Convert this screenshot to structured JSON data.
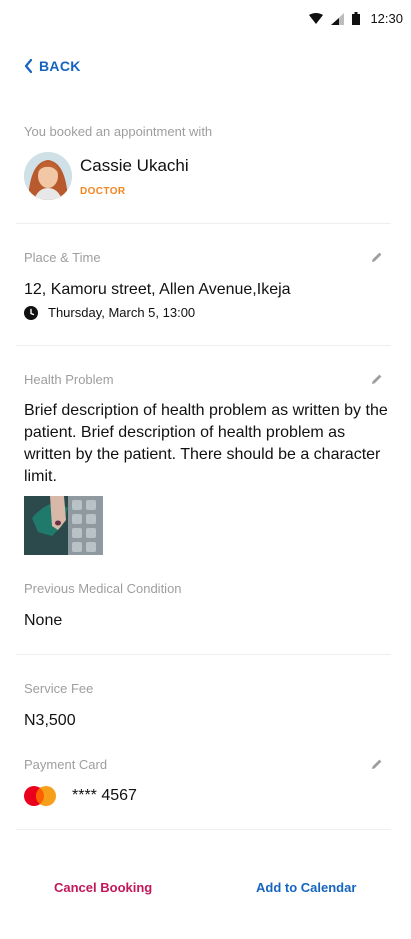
{
  "status_bar": {
    "time": "12:30",
    "icons": [
      "wifi-icon",
      "signal-icon",
      "battery-icon"
    ]
  },
  "nav": {
    "back_label": "BACK"
  },
  "doctor": {
    "intro": "You booked an appointment with",
    "name": "Cassie Ukachi",
    "role": "DOCTOR"
  },
  "place_time": {
    "label": "Place & Time",
    "address": "12, Kamoru street, Allen Avenue,Ikeja",
    "datetime": "Thursday, March 5, 13:00"
  },
  "health": {
    "label": "Health Problem",
    "description": "Brief description of health problem as written by the patient. Brief description of health problem as written by the patient. There should be a character limit."
  },
  "previous_condition": {
    "label": "Previous Medical Condition",
    "value": "None"
  },
  "service_fee": {
    "label": "Service Fee",
    "value": "N3,500"
  },
  "payment": {
    "label": "Payment Card",
    "card_number": "**** 4567",
    "card_brand_icon": "mastercard-icon"
  },
  "footer": {
    "cancel_label": "Cancel Booking",
    "calendar_label": "Add to Calendar"
  },
  "colors": {
    "accent": "#1565c0",
    "cancel": "#c2185b",
    "role": "#f5841f",
    "label": "#9e9e9e"
  }
}
